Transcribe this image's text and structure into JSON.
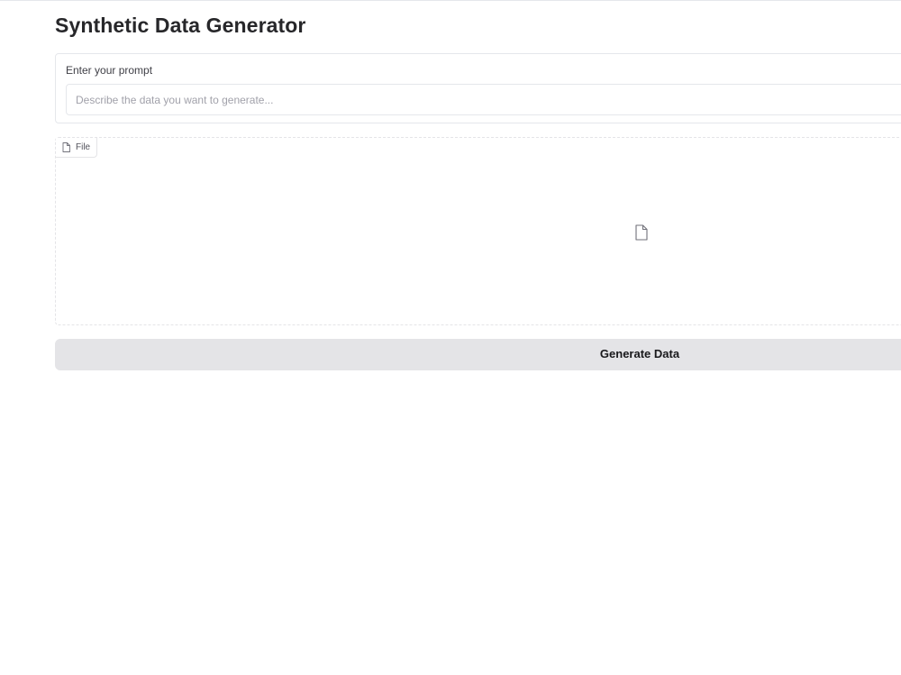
{
  "page": {
    "title": "Synthetic Data Generator"
  },
  "prompt": {
    "label": "Enter your prompt",
    "placeholder": "Describe the data you want to generate...",
    "value": ""
  },
  "file_upload": {
    "tag_label": "File",
    "tag_icon": "file-icon",
    "drop_icon": "file-icon"
  },
  "actions": {
    "generate_label": "Generate Data"
  },
  "colors": {
    "button_bg": "#e4e4e7",
    "border": "#e5e7eb",
    "title": "#27272a"
  }
}
